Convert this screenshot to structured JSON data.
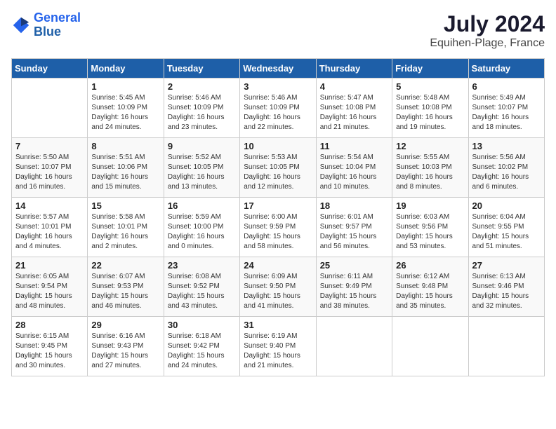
{
  "header": {
    "logo_line1": "General",
    "logo_line2": "Blue",
    "month_year": "July 2024",
    "location": "Equihen-Plage, France"
  },
  "weekdays": [
    "Sunday",
    "Monday",
    "Tuesday",
    "Wednesday",
    "Thursday",
    "Friday",
    "Saturday"
  ],
  "weeks": [
    [
      {
        "day": "",
        "info": ""
      },
      {
        "day": "1",
        "info": "Sunrise: 5:45 AM\nSunset: 10:09 PM\nDaylight: 16 hours\nand 24 minutes."
      },
      {
        "day": "2",
        "info": "Sunrise: 5:46 AM\nSunset: 10:09 PM\nDaylight: 16 hours\nand 23 minutes."
      },
      {
        "day": "3",
        "info": "Sunrise: 5:46 AM\nSunset: 10:09 PM\nDaylight: 16 hours\nand 22 minutes."
      },
      {
        "day": "4",
        "info": "Sunrise: 5:47 AM\nSunset: 10:08 PM\nDaylight: 16 hours\nand 21 minutes."
      },
      {
        "day": "5",
        "info": "Sunrise: 5:48 AM\nSunset: 10:08 PM\nDaylight: 16 hours\nand 19 minutes."
      },
      {
        "day": "6",
        "info": "Sunrise: 5:49 AM\nSunset: 10:07 PM\nDaylight: 16 hours\nand 18 minutes."
      }
    ],
    [
      {
        "day": "7",
        "info": "Sunrise: 5:50 AM\nSunset: 10:07 PM\nDaylight: 16 hours\nand 16 minutes."
      },
      {
        "day": "8",
        "info": "Sunrise: 5:51 AM\nSunset: 10:06 PM\nDaylight: 16 hours\nand 15 minutes."
      },
      {
        "day": "9",
        "info": "Sunrise: 5:52 AM\nSunset: 10:05 PM\nDaylight: 16 hours\nand 13 minutes."
      },
      {
        "day": "10",
        "info": "Sunrise: 5:53 AM\nSunset: 10:05 PM\nDaylight: 16 hours\nand 12 minutes."
      },
      {
        "day": "11",
        "info": "Sunrise: 5:54 AM\nSunset: 10:04 PM\nDaylight: 16 hours\nand 10 minutes."
      },
      {
        "day": "12",
        "info": "Sunrise: 5:55 AM\nSunset: 10:03 PM\nDaylight: 16 hours\nand 8 minutes."
      },
      {
        "day": "13",
        "info": "Sunrise: 5:56 AM\nSunset: 10:02 PM\nDaylight: 16 hours\nand 6 minutes."
      }
    ],
    [
      {
        "day": "14",
        "info": "Sunrise: 5:57 AM\nSunset: 10:01 PM\nDaylight: 16 hours\nand 4 minutes."
      },
      {
        "day": "15",
        "info": "Sunrise: 5:58 AM\nSunset: 10:01 PM\nDaylight: 16 hours\nand 2 minutes."
      },
      {
        "day": "16",
        "info": "Sunrise: 5:59 AM\nSunset: 10:00 PM\nDaylight: 16 hours\nand 0 minutes."
      },
      {
        "day": "17",
        "info": "Sunrise: 6:00 AM\nSunset: 9:59 PM\nDaylight: 15 hours\nand 58 minutes."
      },
      {
        "day": "18",
        "info": "Sunrise: 6:01 AM\nSunset: 9:57 PM\nDaylight: 15 hours\nand 56 minutes."
      },
      {
        "day": "19",
        "info": "Sunrise: 6:03 AM\nSunset: 9:56 PM\nDaylight: 15 hours\nand 53 minutes."
      },
      {
        "day": "20",
        "info": "Sunrise: 6:04 AM\nSunset: 9:55 PM\nDaylight: 15 hours\nand 51 minutes."
      }
    ],
    [
      {
        "day": "21",
        "info": "Sunrise: 6:05 AM\nSunset: 9:54 PM\nDaylight: 15 hours\nand 48 minutes."
      },
      {
        "day": "22",
        "info": "Sunrise: 6:07 AM\nSunset: 9:53 PM\nDaylight: 15 hours\nand 46 minutes."
      },
      {
        "day": "23",
        "info": "Sunrise: 6:08 AM\nSunset: 9:52 PM\nDaylight: 15 hours\nand 43 minutes."
      },
      {
        "day": "24",
        "info": "Sunrise: 6:09 AM\nSunset: 9:50 PM\nDaylight: 15 hours\nand 41 minutes."
      },
      {
        "day": "25",
        "info": "Sunrise: 6:11 AM\nSunset: 9:49 PM\nDaylight: 15 hours\nand 38 minutes."
      },
      {
        "day": "26",
        "info": "Sunrise: 6:12 AM\nSunset: 9:48 PM\nDaylight: 15 hours\nand 35 minutes."
      },
      {
        "day": "27",
        "info": "Sunrise: 6:13 AM\nSunset: 9:46 PM\nDaylight: 15 hours\nand 32 minutes."
      }
    ],
    [
      {
        "day": "28",
        "info": "Sunrise: 6:15 AM\nSunset: 9:45 PM\nDaylight: 15 hours\nand 30 minutes."
      },
      {
        "day": "29",
        "info": "Sunrise: 6:16 AM\nSunset: 9:43 PM\nDaylight: 15 hours\nand 27 minutes."
      },
      {
        "day": "30",
        "info": "Sunrise: 6:18 AM\nSunset: 9:42 PM\nDaylight: 15 hours\nand 24 minutes."
      },
      {
        "day": "31",
        "info": "Sunrise: 6:19 AM\nSunset: 9:40 PM\nDaylight: 15 hours\nand 21 minutes."
      },
      {
        "day": "",
        "info": ""
      },
      {
        "day": "",
        "info": ""
      },
      {
        "day": "",
        "info": ""
      }
    ]
  ]
}
